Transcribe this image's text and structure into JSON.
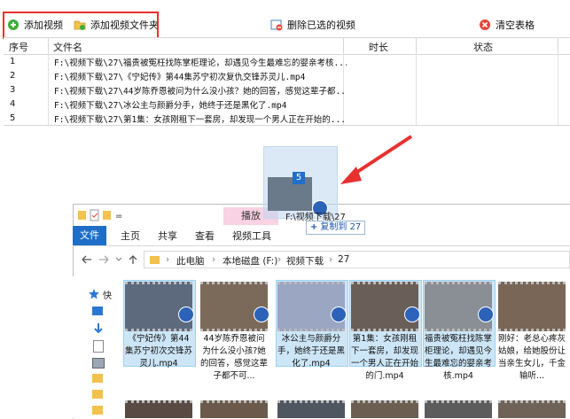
{
  "toolbar": {
    "add_video": "添加视频",
    "add_folder": "添加视频文件夹",
    "delete_selected": "删除已选的视频",
    "clear_table": "清空表格"
  },
  "table": {
    "columns": [
      "序号",
      "文件名",
      "时长",
      "状态"
    ],
    "rows": [
      {
        "num": "1",
        "file": "F:\\视频下载\\27\\福贵被冤枉找陈掌柜理论，却遇见今生最难忘的婴亲考核..."
      },
      {
        "num": "2",
        "file": "F:\\视频下载\\27\\《宁妃传》第44集苏宁初次复仇交锋苏灵儿.mp4"
      },
      {
        "num": "3",
        "file": "F:\\视频下载\\27\\44岁陈乔恩被问为什么没小孩？她的回答，感觉这辈子都..."
      },
      {
        "num": "4",
        "file": "F:\\视频下载\\27\\冰公主与颜爵分手，她终于还是黑化了.mp4"
      },
      {
        "num": "5",
        "file": "F:\\视频下载\\27\\第1集：女孩刚租下一套房，却发现一个男人正在开始的..."
      }
    ]
  },
  "drag": {
    "count": "5",
    "label": "F:\\视频下载\\27",
    "tip_icon": "+",
    "tip": "复制到 27"
  },
  "explorer": {
    "play_tab": "播放",
    "tabs": [
      "文件",
      "主页",
      "共享",
      "查看",
      "视频工具"
    ],
    "breadcrumb": [
      "此电脑",
      "本地磁盘 (F:)",
      "视频下载",
      "27"
    ],
    "nav_quick": "快",
    "files": [
      {
        "name": "《宁妃传》第44集苏宁初次交锋苏灵儿.mp4",
        "selected": true
      },
      {
        "name": "44岁陈乔恩被问为什么没小孩?她的回答，感觉这辈子都不可...",
        "selected": false
      },
      {
        "name": "冰公主与颜爵分手，她终于还是黑化了.mp4",
        "selected": true
      },
      {
        "name": "第1集：女孩刚租下一套房，却发现一个男人正在开始的门.mp4",
        "selected": true
      },
      {
        "name": "福贵被冤枉找陈掌柜理论，却遇见今生最难忘的婴亲考核.mp4",
        "selected": true
      },
      {
        "name": "刚好：老总心疼灰姑娘，给她股份让当亲生女儿，千金输听...",
        "selected": false
      }
    ]
  },
  "colors": {
    "highlight": "#e8312f",
    "accent": "#1e6ec8",
    "selection": "#cde6f7"
  }
}
